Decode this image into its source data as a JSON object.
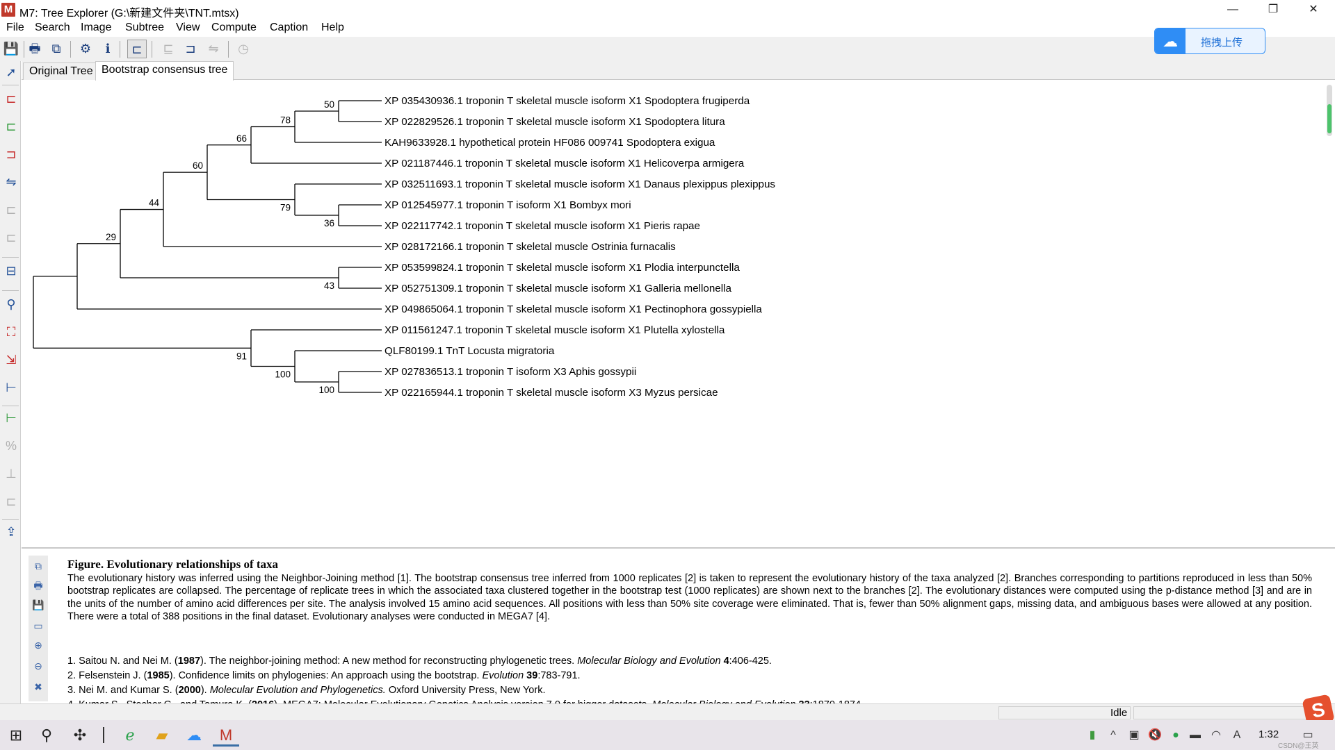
{
  "window": {
    "app_icon_letter": "M",
    "title": "M7: Tree Explorer (G:\\新建文件夹\\TNT.mtsx)",
    "minimize_glyph": "—",
    "restore_glyph": "❐",
    "close_glyph": "✕"
  },
  "menu": [
    "File",
    "Search",
    "Image",
    "Subtree",
    "View",
    "Compute",
    "Caption",
    "Help"
  ],
  "upload_button": {
    "label": "拖拽上传",
    "icon": "cloud-upload-icon"
  },
  "tabs": [
    {
      "label": "Original Tree",
      "active": false
    },
    {
      "label": "Bootstrap consensus tree",
      "active": true
    }
  ],
  "tree": {
    "taxa": [
      "XP 035430936.1 troponin T skeletal muscle isoform X1 Spodoptera frugiperda",
      "XP 022829526.1 troponin T skeletal muscle isoform X1 Spodoptera litura",
      "KAH9633928.1 hypothetical protein HF086 009741 Spodoptera exigua",
      "XP 021187446.1 troponin T skeletal muscle isoform X1 Helicoverpa armigera",
      "XP 032511693.1 troponin T skeletal muscle isoform X1 Danaus plexippus plexippus",
      "XP 012545977.1 troponin T isoform X1 Bombyx mori",
      "XP 022117742.1 troponin T skeletal muscle isoform X1 Pieris rapae",
      "XP 028172166.1 troponin T skeletal muscle Ostrinia furnacalis",
      "XP 053599824.1 troponin T skeletal muscle isoform X1 Plodia interpunctella",
      "XP 052751309.1 troponin T skeletal muscle isoform X1 Galleria mellonella",
      "XP 049865064.1 troponin T skeletal muscle isoform X1 Pectinophora gossypiella",
      "XP 011561247.1 troponin T skeletal muscle isoform X1 Plutella xylostella",
      "QLF80199.1 TnT Locusta migratoria",
      "XP 027836513.1 troponin T isoform X3 Aphis gossypii",
      "XP 022165944.1 troponin T skeletal muscle isoform X3 Myzus persicae"
    ],
    "bootstrap_values": [
      "50",
      "78",
      "66",
      "60",
      "79",
      "36",
      "44",
      "29",
      "43",
      "91",
      "100",
      "100"
    ],
    "line_color": "#000000"
  },
  "caption": {
    "title": "Figure. Evolutionary relationships of taxa",
    "body": "The evolutionary history was inferred using the Neighbor-Joining method [1]. The bootstrap consensus tree inferred from 1000 replicates [2] is taken to represent the evolutionary history of the taxa analyzed [2]. Branches corresponding to partitions reproduced in less than 50% bootstrap replicates are collapsed. The percentage of replicate trees in which the associated taxa clustered together in the bootstrap test (1000 replicates) are shown next to the branches [2]. The evolutionary distances were computed using the p-distance method [3] and are in the units of the number of amino acid differences per site. The analysis involved 15 amino acid sequences. All positions with less than 50% site coverage were eliminated. That is, fewer than 50% alignment gaps, missing data, and ambiguous bases were allowed at any position. There were a total of 388 positions in the final dataset. Evolutionary analyses were conducted in MEGA7 [4].",
    "refs": [
      {
        "lead": "1. Saitou N. and Nei M. (",
        "year": "1987",
        "mid": "). The neighbor-joining method: A new method for reconstructing phylogenetic trees. ",
        "journal": "Molecular Biology and Evolution",
        "vol": " 4",
        "tail": ":406-425."
      },
      {
        "lead": "2. Felsenstein J. (",
        "year": "1985",
        "mid": "). Confidence limits on phylogenies: An approach using the bootstrap. ",
        "journal": "Evolution",
        "vol": " 39",
        "tail": ":783-791."
      },
      {
        "lead": "3. Nei M. and Kumar S. (",
        "year": "2000",
        "mid": "). ",
        "journal": "Molecular Evolution and Phylogenetics.",
        "vol": "",
        "tail": " Oxford University Press, New York."
      },
      {
        "lead": "4. Kumar S., Stecher G., and Tamura K. (",
        "year": "2016",
        "mid": "). MEGA7: Molecular Evolutionary Genetics Analysis version 7.0 for bigger datasets. ",
        "journal": "Molecular Biology and Evolution",
        "vol": " 33",
        "tail": ":1870-1874."
      }
    ]
  },
  "status": {
    "text": "Idle"
  },
  "taskbar": {
    "clock": "1:32",
    "watermark": "CSDN@王英"
  },
  "colors": {
    "accent": "#2f8df5",
    "app_icon": "#c0392b",
    "scroll_green": "#4cc36b"
  }
}
